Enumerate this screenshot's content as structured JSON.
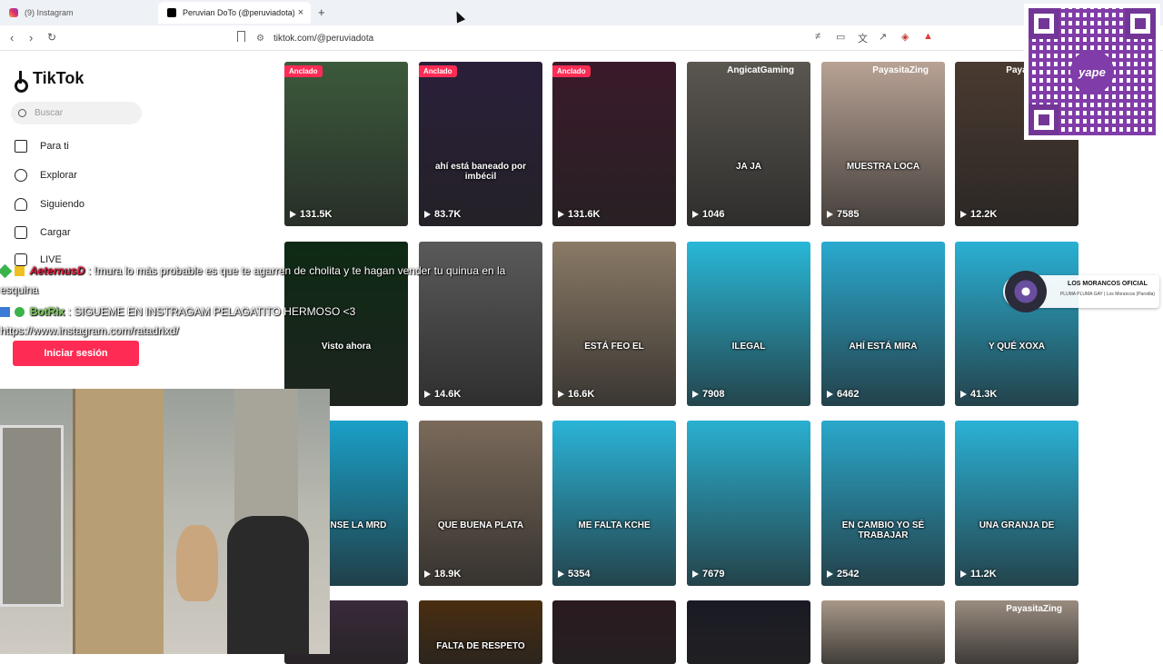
{
  "browser": {
    "tabs": [
      {
        "title": "(9) Instagram",
        "active": false
      },
      {
        "title": "Peruvian DoTo (@peruviadota) | ",
        "active": true
      }
    ],
    "close_glyph": "×",
    "new_tab_glyph": "+",
    "back_glyph": "‹",
    "forward_glyph": "›",
    "reload_glyph": "↻",
    "url": "tiktok.com/@peruviadota",
    "site_info_glyph": "⚙"
  },
  "sidebar": {
    "brand": "TikTok",
    "search_placeholder": "Buscar",
    "items": [
      {
        "label": "Para ti",
        "icon": "home-icon"
      },
      {
        "label": "Explorar",
        "icon": "compass-icon"
      },
      {
        "label": "Siguiendo",
        "icon": "people-icon"
      },
      {
        "label": "Cargar",
        "icon": "plus-square-icon"
      },
      {
        "label": "LIVE",
        "icon": "live-icon"
      }
    ],
    "login_label": "Iniciar sesión"
  },
  "videos": [
    {
      "views": "131.5K",
      "pinned": "Anclado",
      "bg": "#3c5a3c"
    },
    {
      "views": "83.7K",
      "pinned": "Anclado",
      "bg": "#2a1f3a",
      "caption": "ahí está baneado por imbécil"
    },
    {
      "views": "131.6K",
      "pinned": "Anclado",
      "bg": "#3a1a2a"
    },
    {
      "views": "1046",
      "bg": "#5a5650",
      "uname": "AngicatGaming",
      "caption": "JA JA"
    },
    {
      "views": "7585",
      "bg": "#b8a294",
      "uname": "PayasitaZing",
      "caption": "MUESTRA LOCA"
    },
    {
      "views": "12.2K",
      "bg": "#4a3a30",
      "uname": "PayasitaZing"
    },
    {
      "views": "",
      "bg": "#0e2a14",
      "caption": "Visto ahora"
    },
    {
      "views": "14.6K",
      "bg": "#5a5a5a"
    },
    {
      "views": "16.6K",
      "bg": "#8a7a66",
      "caption": "ESTÁ FEO EL"
    },
    {
      "views": "7908",
      "bg": "#29b8d8",
      "caption": "ILEGAL"
    },
    {
      "views": "6462",
      "bg": "#2aaad0",
      "caption": "AHÍ ESTÁ MIRA"
    },
    {
      "views": "41.3K",
      "bg": "#2ab0d4",
      "caption": "Y QUÉ XOXA"
    },
    {
      "views": "",
      "bg": "#1aa0c8",
      "caption": "VÁYANSE LA MRD"
    },
    {
      "views": "18.9K",
      "bg": "#7a6a5a",
      "caption": "QUE BUENA PLATA"
    },
    {
      "views": "5354",
      "bg": "#2ab4d8",
      "caption": "ME FALTA KCHE"
    },
    {
      "views": "7679",
      "bg": "#2ab0d0"
    },
    {
      "views": "2542",
      "bg": "#2aa8cc",
      "caption": "EN CAMBIO YO SÉ TRABAJAR"
    },
    {
      "views": "11.2K",
      "bg": "#2ab2d6",
      "caption": "UNA GRANJA DE"
    },
    {
      "views": "",
      "bg": "#3a2a3a"
    },
    {
      "views": "",
      "bg": "#4a2e10",
      "caption": "FALTA DE RESPETO"
    },
    {
      "views": "",
      "bg": "#2a1a20"
    },
    {
      "views": "",
      "bg": "#1a1a24"
    },
    {
      "views": "",
      "bg": "#a89888"
    },
    {
      "views": "",
      "bg": "#9a8c80",
      "uname": "PayasitaZing"
    }
  ],
  "stream_overlay": {
    "chat": [
      {
        "user": "AeternusD",
        "text": ": !mura lo más probable es que te agarren de cholita y te hagan vender tu quinua en la esquina"
      },
      {
        "user": "BotRix",
        "text": ": SIGUEME EN INSTRAGAM PELAGATITO HERMOSO <3 https://www.instagram.com/ratadrixd/"
      }
    ],
    "promo_title": "LOS MORANCOS OFICIAL",
    "promo_sub": "PLUMA PLUMA GAY | Los Morancos (Parodia)",
    "qr_brand": "yape"
  }
}
